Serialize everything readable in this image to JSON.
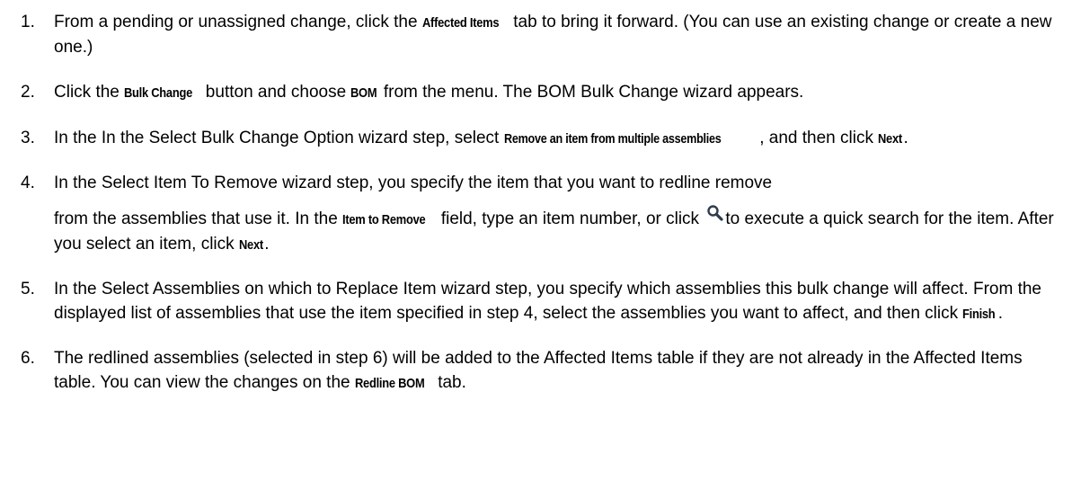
{
  "steps": [
    {
      "number": "1.",
      "t1": "From a pending or unassigned change, click the ",
      "b1": "Affected Items",
      "t2": " tab to bring it forward. (You can use an existing change or create a new one.)"
    },
    {
      "number": "2.",
      "t1": "Click the ",
      "b1": "Bulk Change",
      "t2": " button and choose ",
      "b2": "BOM",
      "t3": " from the menu. The BOM Bulk Change wizard appears."
    },
    {
      "number": "3.",
      "t1": "In the In the Select Bulk Change Option wizard step, select ",
      "b1": "Remove an item from multiple assemblies",
      "t2": ", and then click ",
      "b2": "Next",
      "t3": "."
    },
    {
      "number": "4.",
      "t1": "In the Select Item To Remove wizard step, you specify the item that you want to redline remove",
      "t2": "from the assemblies that use it. In the ",
      "b1": "Item to Remove",
      "t3": " field, type an item number, or click ",
      "t4": "to execute a quick search for the item.  After you select an item, click ",
      "b2": "Next",
      "t5": "."
    },
    {
      "number": "5.",
      "t1": "In the Select Assemblies on which to Replace Item wizard step, you specify which assemblies this bulk change will affect. From the displayed list of assemblies that use the item specified in step 4, select the assemblies you want to affect, and then click ",
      "b1": "Finish",
      "t2": "."
    },
    {
      "number": "6.",
      "t1": "The redlined assemblies (selected in step 6) will be added to the Affected Items table if they are not already in the Affected Items table. You can view the changes on the ",
      "b1": "Redline BOM",
      "t2": " tab."
    }
  ],
  "icons": {
    "search": "search-icon"
  }
}
